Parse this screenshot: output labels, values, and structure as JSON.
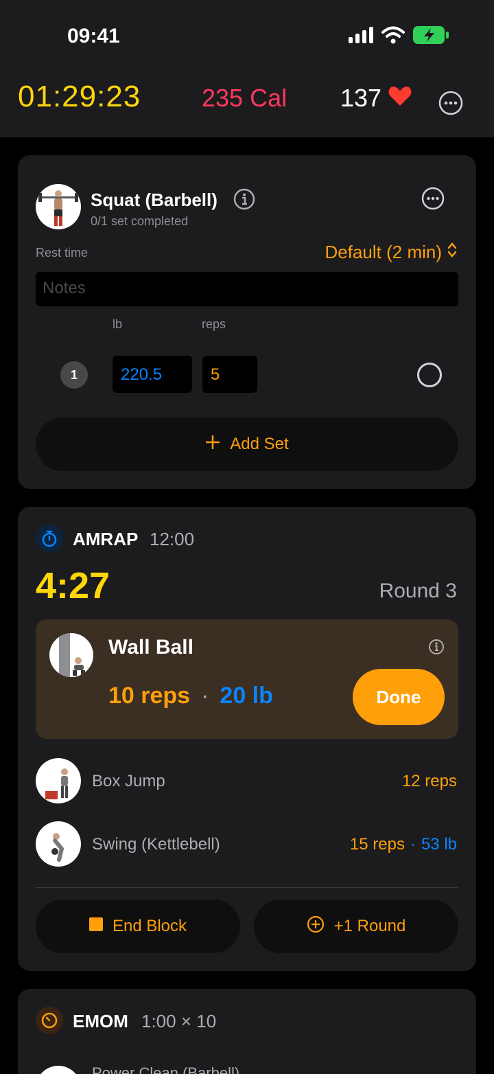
{
  "status": {
    "time": "09:41"
  },
  "header": {
    "elapsed": "01:29:23",
    "calories": "235 Cal",
    "heart_rate": "137"
  },
  "exercise": {
    "name": "Squat (Barbell)",
    "progress": "0/1 set completed",
    "rest_label": "Rest time",
    "rest_value": "Default (2 min)",
    "notes_placeholder": "Notes",
    "col_weight": "lb",
    "col_reps": "reps",
    "sets": [
      {
        "number": "1",
        "weight": "220.5",
        "reps": "5"
      }
    ],
    "add_set": "Add Set"
  },
  "amrap": {
    "type": "AMRAP",
    "duration": "12:00",
    "remaining": "4:27",
    "round": "Round 3",
    "current": {
      "name": "Wall Ball",
      "reps": "10 reps",
      "weight": "20 lb",
      "done": "Done"
    },
    "queue": [
      {
        "name": "Box Jump",
        "reps": "12 reps"
      },
      {
        "name": "Swing (Kettlebell)",
        "reps": "15 reps",
        "sep": "·",
        "weight": "53 lb"
      }
    ],
    "separator": "·",
    "end_block": "End Block",
    "add_round": "+1 Round"
  },
  "emom": {
    "type": "EMOM",
    "params": "1:00 × 10",
    "next_exercise": "Power Clean (Barbell)"
  },
  "colors": {
    "accent": "#ff9f0a",
    "weight": "#0a84ff",
    "timer": "#ffd60a",
    "calories": "#ff375f",
    "heart": "#ff3b30"
  }
}
